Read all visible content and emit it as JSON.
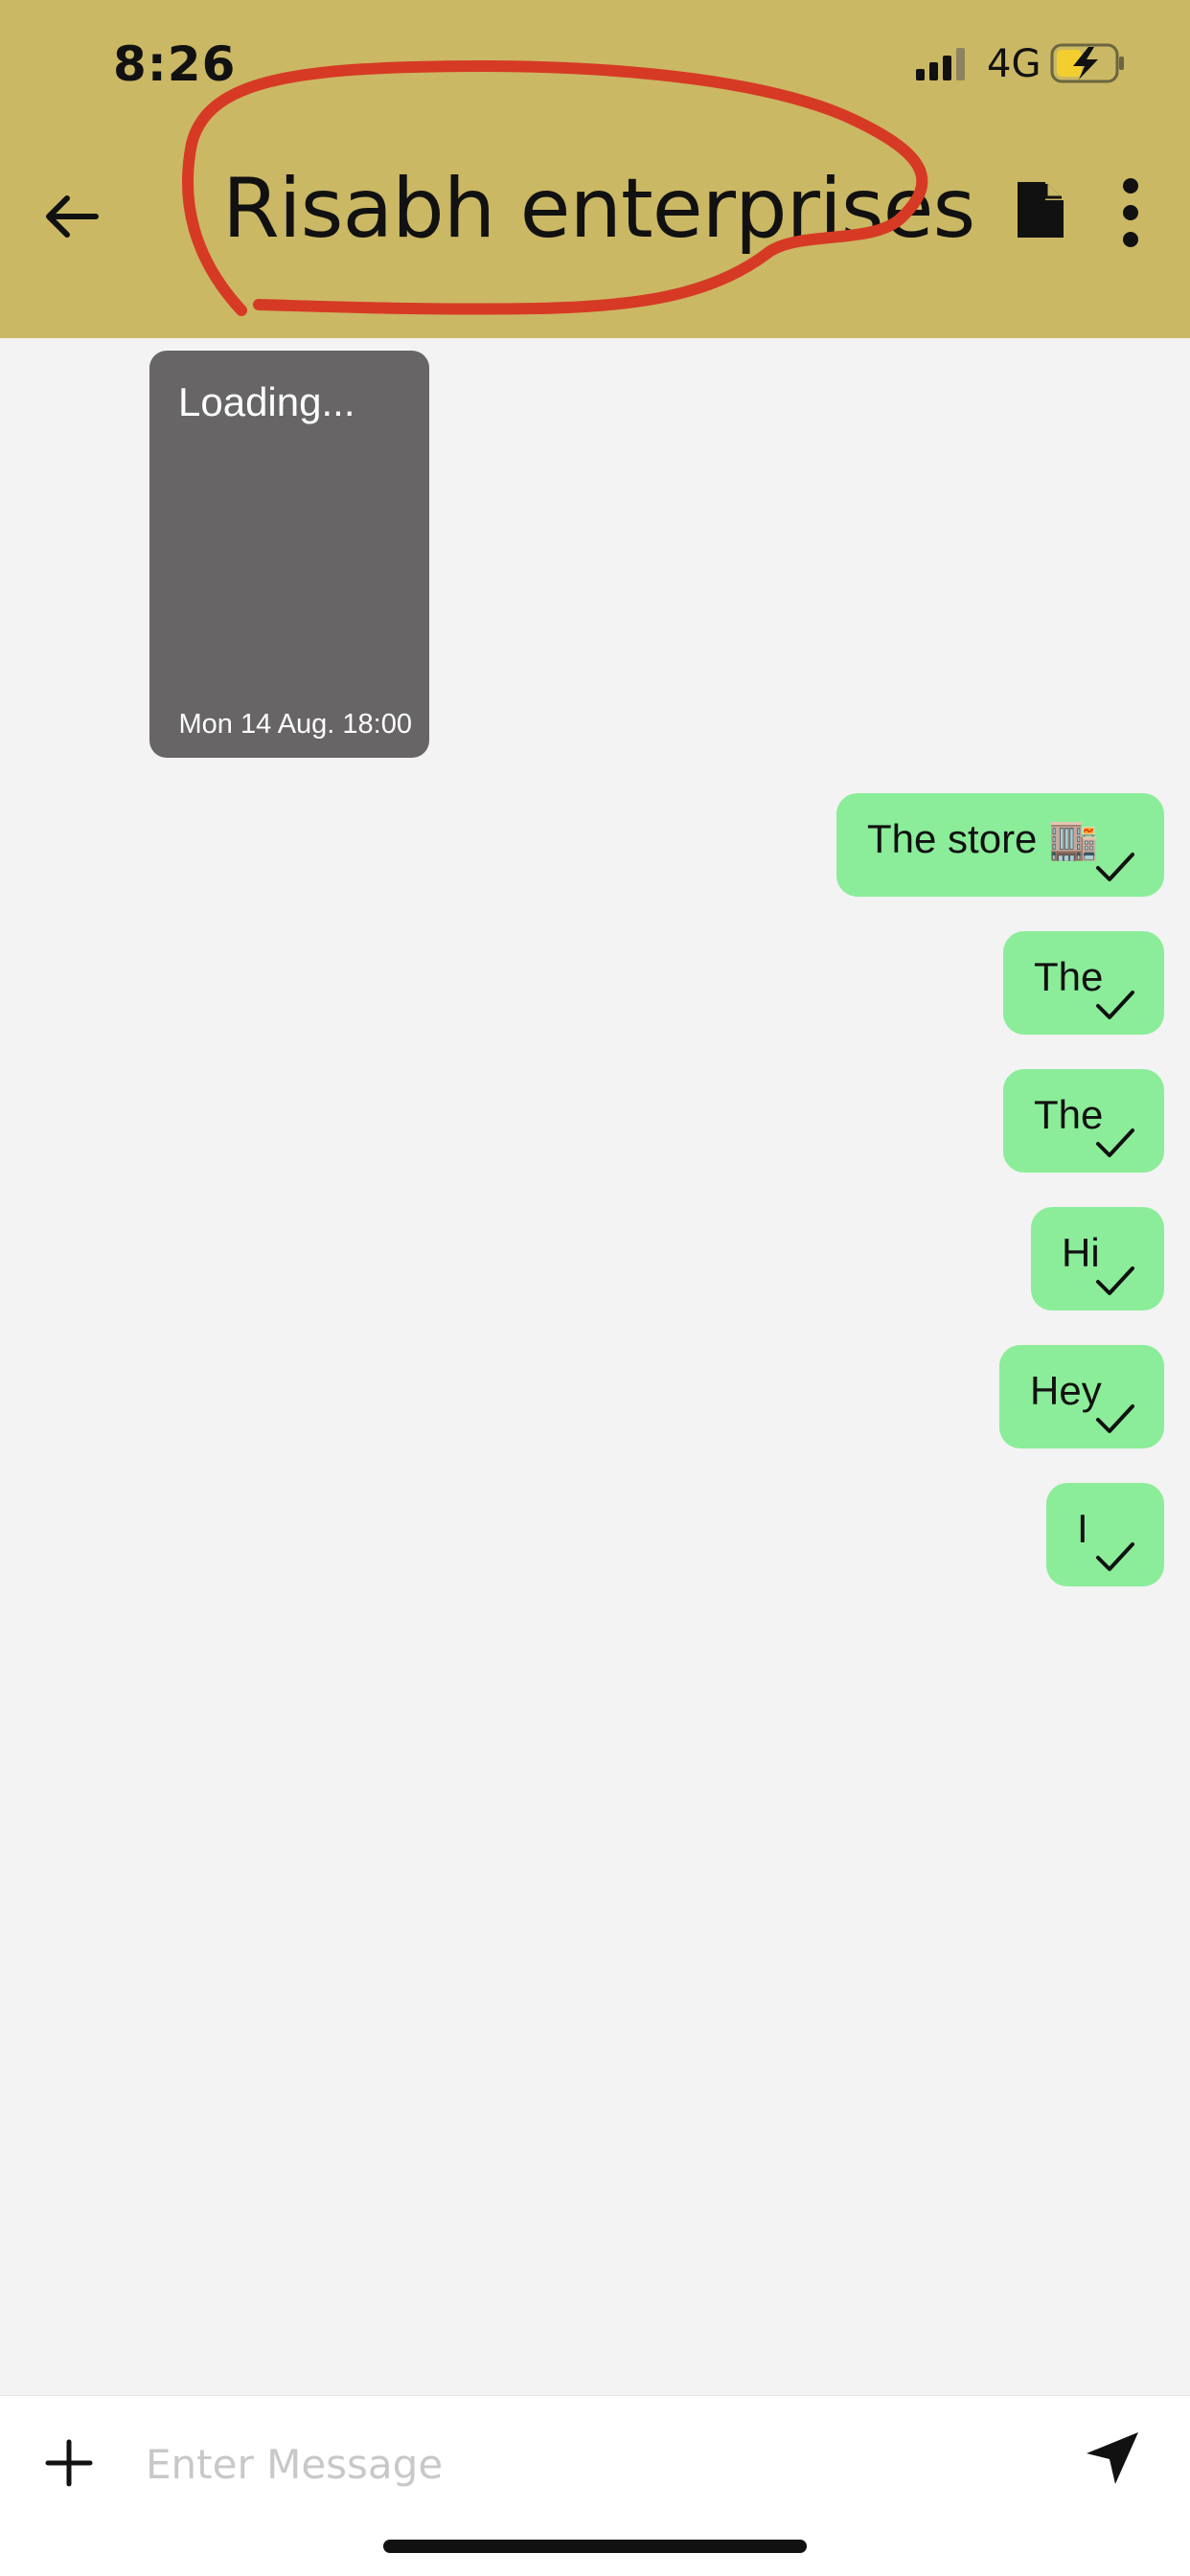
{
  "status_bar": {
    "time": "8:26",
    "network": "4G"
  },
  "header": {
    "title": "Risabh enterprises"
  },
  "messages": {
    "incoming": {
      "text": "Loading...",
      "timestamp": "Mon 14 Aug. 18:00"
    },
    "outgoing": [
      {
        "text": "The store 🏬"
      },
      {
        "text": "The"
      },
      {
        "text": "The"
      },
      {
        "text": "Hi"
      },
      {
        "text": "Hey"
      },
      {
        "text": "I"
      }
    ]
  },
  "composer": {
    "placeholder": "Enter Message"
  },
  "colors": {
    "header_bg": "#cbb864",
    "outgoing_bubble": "#8bed99",
    "incoming_bubble": "#676566",
    "annotation": "#d63a24"
  },
  "icons": [
    "back-arrow-icon",
    "document-icon",
    "more-vertical-icon",
    "plus-icon",
    "send-icon",
    "check-icon"
  ]
}
